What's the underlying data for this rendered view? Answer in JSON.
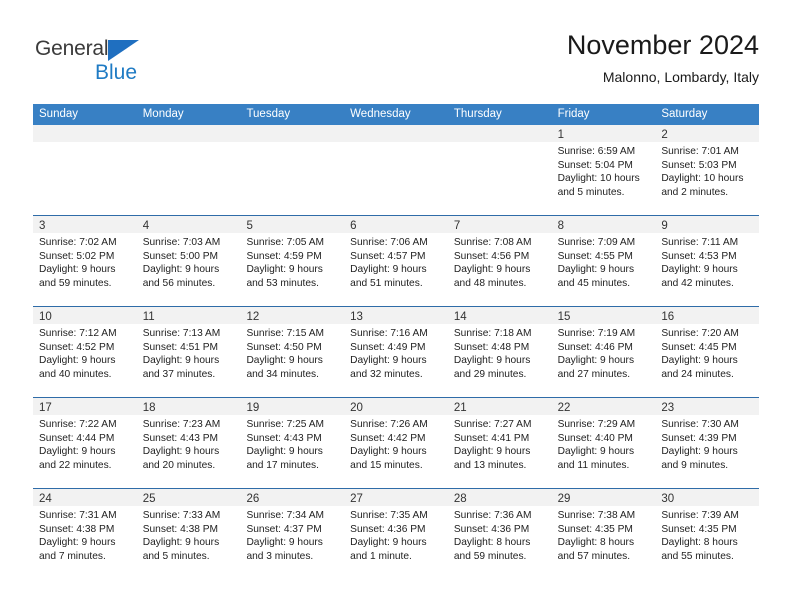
{
  "brand": {
    "name_part1": "General",
    "name_part2": "Blue",
    "triangle_color": "#1f6fc0"
  },
  "header": {
    "title": "November 2024",
    "subtitle": "Malonno, Lombardy, Italy"
  },
  "colors": {
    "header_blue": "#3880c4",
    "row_divider_blue": "#2f6ca8",
    "daynum_strip": "#f2f2f2",
    "brand_blue": "#1f7bc4"
  },
  "calendar": {
    "day_headers": [
      "Sunday",
      "Monday",
      "Tuesday",
      "Wednesday",
      "Thursday",
      "Friday",
      "Saturday"
    ],
    "weeks": [
      [
        {
          "day": "",
          "lines": []
        },
        {
          "day": "",
          "lines": []
        },
        {
          "day": "",
          "lines": []
        },
        {
          "day": "",
          "lines": []
        },
        {
          "day": "",
          "lines": []
        },
        {
          "day": "1",
          "lines": [
            "Sunrise: 6:59 AM",
            "Sunset: 5:04 PM",
            "Daylight: 10 hours",
            "and 5 minutes."
          ]
        },
        {
          "day": "2",
          "lines": [
            "Sunrise: 7:01 AM",
            "Sunset: 5:03 PM",
            "Daylight: 10 hours",
            "and 2 minutes."
          ]
        }
      ],
      [
        {
          "day": "3",
          "lines": [
            "Sunrise: 7:02 AM",
            "Sunset: 5:02 PM",
            "Daylight: 9 hours",
            "and 59 minutes."
          ]
        },
        {
          "day": "4",
          "lines": [
            "Sunrise: 7:03 AM",
            "Sunset: 5:00 PM",
            "Daylight: 9 hours",
            "and 56 minutes."
          ]
        },
        {
          "day": "5",
          "lines": [
            "Sunrise: 7:05 AM",
            "Sunset: 4:59 PM",
            "Daylight: 9 hours",
            "and 53 minutes."
          ]
        },
        {
          "day": "6",
          "lines": [
            "Sunrise: 7:06 AM",
            "Sunset: 4:57 PM",
            "Daylight: 9 hours",
            "and 51 minutes."
          ]
        },
        {
          "day": "7",
          "lines": [
            "Sunrise: 7:08 AM",
            "Sunset: 4:56 PM",
            "Daylight: 9 hours",
            "and 48 minutes."
          ]
        },
        {
          "day": "8",
          "lines": [
            "Sunrise: 7:09 AM",
            "Sunset: 4:55 PM",
            "Daylight: 9 hours",
            "and 45 minutes."
          ]
        },
        {
          "day": "9",
          "lines": [
            "Sunrise: 7:11 AM",
            "Sunset: 4:53 PM",
            "Daylight: 9 hours",
            "and 42 minutes."
          ]
        }
      ],
      [
        {
          "day": "10",
          "lines": [
            "Sunrise: 7:12 AM",
            "Sunset: 4:52 PM",
            "Daylight: 9 hours",
            "and 40 minutes."
          ]
        },
        {
          "day": "11",
          "lines": [
            "Sunrise: 7:13 AM",
            "Sunset: 4:51 PM",
            "Daylight: 9 hours",
            "and 37 minutes."
          ]
        },
        {
          "day": "12",
          "lines": [
            "Sunrise: 7:15 AM",
            "Sunset: 4:50 PM",
            "Daylight: 9 hours",
            "and 34 minutes."
          ]
        },
        {
          "day": "13",
          "lines": [
            "Sunrise: 7:16 AM",
            "Sunset: 4:49 PM",
            "Daylight: 9 hours",
            "and 32 minutes."
          ]
        },
        {
          "day": "14",
          "lines": [
            "Sunrise: 7:18 AM",
            "Sunset: 4:48 PM",
            "Daylight: 9 hours",
            "and 29 minutes."
          ]
        },
        {
          "day": "15",
          "lines": [
            "Sunrise: 7:19 AM",
            "Sunset: 4:46 PM",
            "Daylight: 9 hours",
            "and 27 minutes."
          ]
        },
        {
          "day": "16",
          "lines": [
            "Sunrise: 7:20 AM",
            "Sunset: 4:45 PM",
            "Daylight: 9 hours",
            "and 24 minutes."
          ]
        }
      ],
      [
        {
          "day": "17",
          "lines": [
            "Sunrise: 7:22 AM",
            "Sunset: 4:44 PM",
            "Daylight: 9 hours",
            "and 22 minutes."
          ]
        },
        {
          "day": "18",
          "lines": [
            "Sunrise: 7:23 AM",
            "Sunset: 4:43 PM",
            "Daylight: 9 hours",
            "and 20 minutes."
          ]
        },
        {
          "day": "19",
          "lines": [
            "Sunrise: 7:25 AM",
            "Sunset: 4:43 PM",
            "Daylight: 9 hours",
            "and 17 minutes."
          ]
        },
        {
          "day": "20",
          "lines": [
            "Sunrise: 7:26 AM",
            "Sunset: 4:42 PM",
            "Daylight: 9 hours",
            "and 15 minutes."
          ]
        },
        {
          "day": "21",
          "lines": [
            "Sunrise: 7:27 AM",
            "Sunset: 4:41 PM",
            "Daylight: 9 hours",
            "and 13 minutes."
          ]
        },
        {
          "day": "22",
          "lines": [
            "Sunrise: 7:29 AM",
            "Sunset: 4:40 PM",
            "Daylight: 9 hours",
            "and 11 minutes."
          ]
        },
        {
          "day": "23",
          "lines": [
            "Sunrise: 7:30 AM",
            "Sunset: 4:39 PM",
            "Daylight: 9 hours",
            "and 9 minutes."
          ]
        }
      ],
      [
        {
          "day": "24",
          "lines": [
            "Sunrise: 7:31 AM",
            "Sunset: 4:38 PM",
            "Daylight: 9 hours",
            "and 7 minutes."
          ]
        },
        {
          "day": "25",
          "lines": [
            "Sunrise: 7:33 AM",
            "Sunset: 4:38 PM",
            "Daylight: 9 hours",
            "and 5 minutes."
          ]
        },
        {
          "day": "26",
          "lines": [
            "Sunrise: 7:34 AM",
            "Sunset: 4:37 PM",
            "Daylight: 9 hours",
            "and 3 minutes."
          ]
        },
        {
          "day": "27",
          "lines": [
            "Sunrise: 7:35 AM",
            "Sunset: 4:36 PM",
            "Daylight: 9 hours",
            "and 1 minute."
          ]
        },
        {
          "day": "28",
          "lines": [
            "Sunrise: 7:36 AM",
            "Sunset: 4:36 PM",
            "Daylight: 8 hours",
            "and 59 minutes."
          ]
        },
        {
          "day": "29",
          "lines": [
            "Sunrise: 7:38 AM",
            "Sunset: 4:35 PM",
            "Daylight: 8 hours",
            "and 57 minutes."
          ]
        },
        {
          "day": "30",
          "lines": [
            "Sunrise: 7:39 AM",
            "Sunset: 4:35 PM",
            "Daylight: 8 hours",
            "and 55 minutes."
          ]
        }
      ]
    ]
  }
}
